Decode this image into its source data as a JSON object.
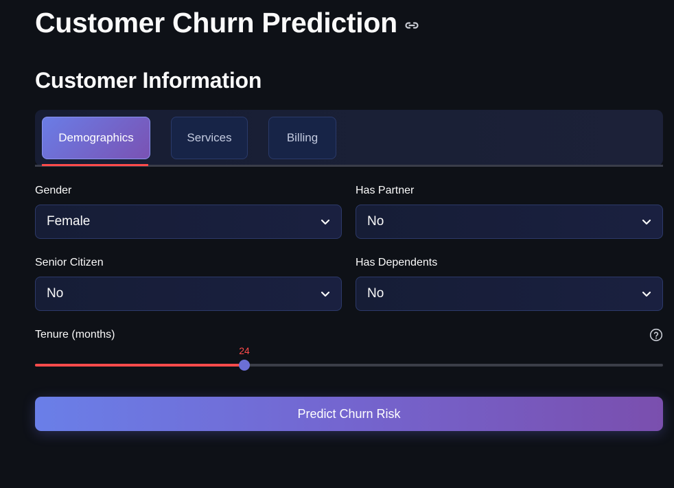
{
  "header": {
    "title": "Customer Churn Prediction",
    "link_icon": "link-icon"
  },
  "section": {
    "title": "Customer Information"
  },
  "tabs": [
    {
      "label": "Demographics",
      "active": true
    },
    {
      "label": "Services",
      "active": false
    },
    {
      "label": "Billing",
      "active": false
    }
  ],
  "form": {
    "gender": {
      "label": "Gender",
      "value": "Female"
    },
    "has_partner": {
      "label": "Has Partner",
      "value": "No"
    },
    "senior_citizen": {
      "label": "Senior Citizen",
      "value": "No"
    },
    "has_dependents": {
      "label": "Has Dependents",
      "value": "No"
    },
    "tenure": {
      "label": "Tenure (months)",
      "value": 24,
      "value_text": "24",
      "fraction": 0.333,
      "help_icon": "help-circle-icon"
    }
  },
  "predict_button": {
    "label": "Predict Churn Risk"
  },
  "colors": {
    "background": "#0e1117",
    "accent": "#ff4b4b",
    "gradient_start": "#6a7fe8",
    "gradient_end": "#7a4fae"
  }
}
